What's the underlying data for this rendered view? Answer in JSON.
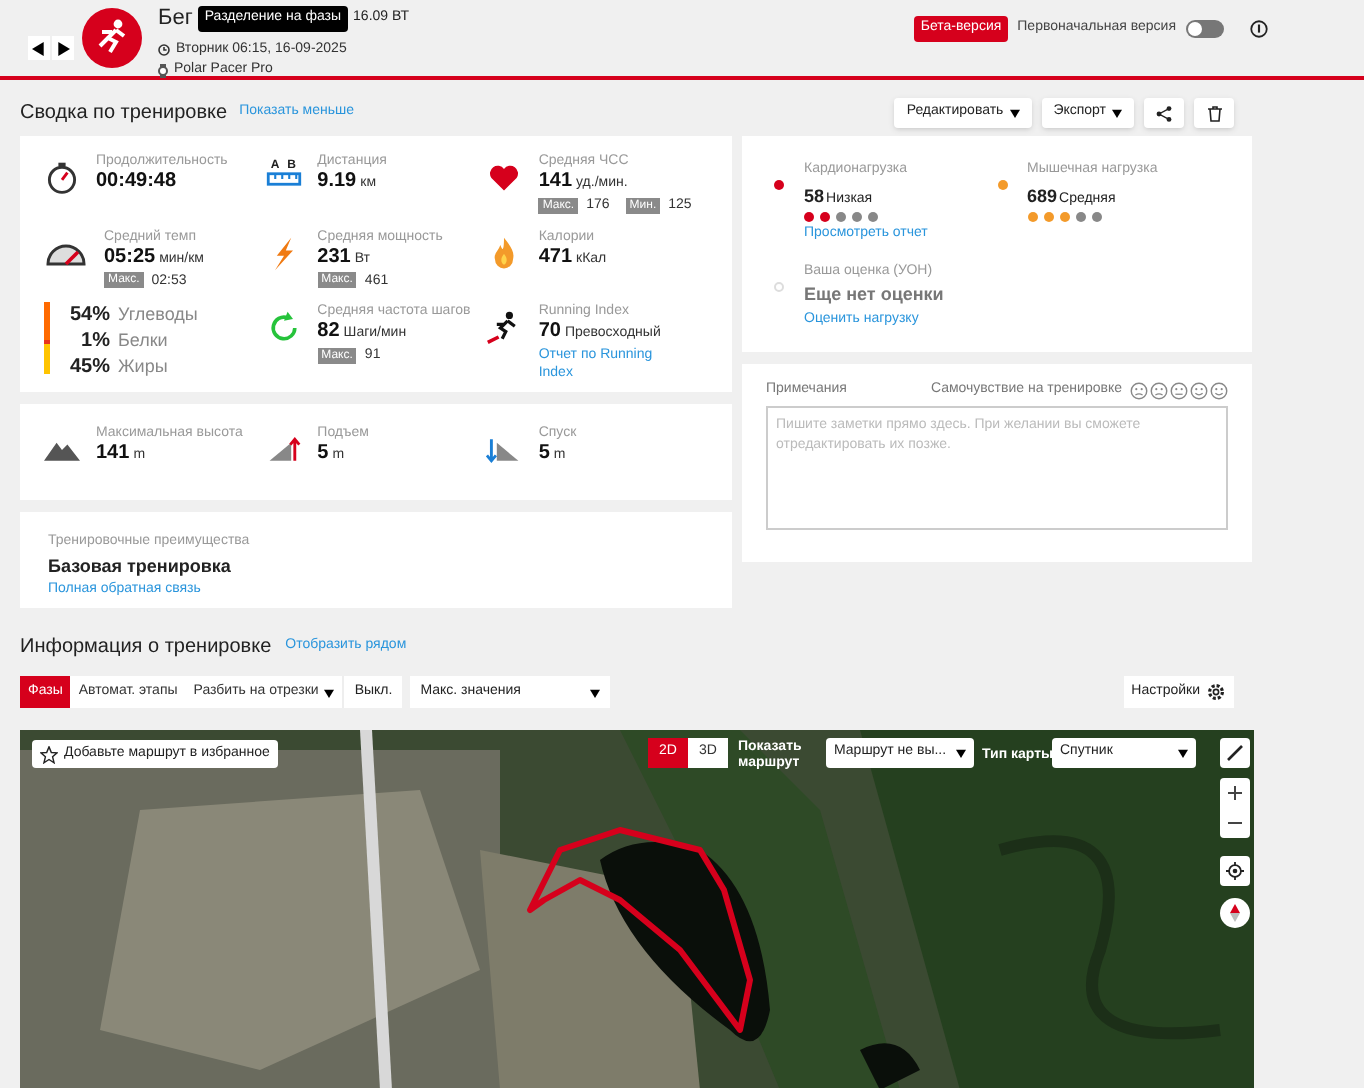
{
  "header": {
    "sport": "Бег",
    "phase_badge": "Разделение на фазы",
    "power": "16.09 ВТ",
    "date": "Вторник 06:15, 16-09-2025",
    "device": "Polar Pacer Pro",
    "beta": "Бета-версия",
    "original_version": {
      "label": "Первоначальная версия",
      "on": false
    }
  },
  "summary": {
    "title": "Сводка по тренировке",
    "link": "Показать меньше",
    "buttons": [
      "Редактировать",
      "Экспорт"
    ]
  },
  "metrics": [
    {
      "kind": "stopwatch",
      "label": "Продолжительность",
      "value": "00:49:48"
    },
    {
      "kind": "distance",
      "label": "Дистанция",
      "value": "9.19",
      "unit": "км",
      "icon_letters": [
        "A",
        "B"
      ]
    },
    {
      "kind": "heart",
      "label": "Средняя ЧСС",
      "value": "141",
      "unit": "уд./мин.",
      "extras": [
        {
          "tag": "Макс.",
          "value": "176"
        },
        {
          "tag": "Мин.",
          "value": "125"
        }
      ]
    },
    {
      "kind": "gauge",
      "label": "Средний темп",
      "value": "05:25",
      "unit": "мин/км",
      "extras": [
        {
          "tag": "Макс.",
          "value": "02:53"
        }
      ]
    },
    {
      "kind": "bolt",
      "label": "Средняя мощность",
      "value": "231",
      "unit": "Вт",
      "extras": [
        {
          "tag": "Макс.",
          "value": "461"
        }
      ]
    },
    {
      "kind": "flame",
      "label": "Калории",
      "value": "471",
      "unit": "кКал"
    },
    {
      "kind": "macros",
      "items": [
        {
          "pct": "54%",
          "label": "Углеводы",
          "color": "#ff6a00"
        },
        {
          "pct": "1%",
          "label": "Белки",
          "color": "#e8331c"
        },
        {
          "pct": "45%",
          "label": "Жиры",
          "color": "#ffc400"
        }
      ]
    },
    {
      "kind": "cadence",
      "label": "Средняя частота шагов",
      "value": "82",
      "unit": "Шаги/мин",
      "extras": [
        {
          "tag": "Макс.",
          "value": "91"
        }
      ]
    },
    {
      "kind": "runner",
      "label": "Running Index",
      "value": "70",
      "unit": "Превосходный",
      "link": "Отчет по Running Index"
    }
  ],
  "elevation": [
    {
      "kind": "mountain",
      "label": "Максимальная высота",
      "value": "141",
      "unit": "m"
    },
    {
      "kind": "ascent",
      "label": "Подъем",
      "value": "5",
      "unit": "m"
    },
    {
      "kind": "descent",
      "label": "Спуск",
      "value": "5",
      "unit": "m"
    }
  ],
  "benefit": {
    "label": "Тренировочные преимущества",
    "value": "Базовая тренировка",
    "link": "Полная обратная связь"
  },
  "load": [
    {
      "label": "Кардионагрузка",
      "value": "58",
      "rating": "Низкая",
      "color": "#d6001c",
      "stars": 2,
      "link": "Просмотреть отчет"
    },
    {
      "label": "Мышечная нагрузка",
      "value": "689",
      "rating": "Средняя",
      "color": "#f39a2a",
      "stars": 3
    }
  ],
  "rpe": {
    "label": "Ваша оценка (УОН)",
    "value": "Еще нет оценки",
    "link": "Оценить нагрузку"
  },
  "notes": {
    "label": "Примечания",
    "feeling": "Самочувствие на тренировке",
    "placeholder": "Пишите заметки прямо здесь. При желании вы сможете отредактировать их позже."
  },
  "info": {
    "title": "Информация о тренировке",
    "link": "Отобразить рядом",
    "tabs": [
      {
        "label": "Фазы",
        "selected": true
      },
      {
        "label": "Автомат. этапы",
        "selected": false
      },
      {
        "label": "Разбить на отрезки",
        "selected": false
      }
    ],
    "off": "Выкл.",
    "select": "Макс. значения",
    "settings": "Настройки"
  },
  "map": {
    "favorite": "Добавьте маршрут в избранное",
    "views": [
      {
        "label": "2D",
        "selected": true
      },
      {
        "label": "3D",
        "selected": false
      }
    ],
    "show_route": "Показать маршрут",
    "route_select": "Маршрут не вы...",
    "map_type_label": "Тип карты",
    "map_type": "Спутник"
  }
}
